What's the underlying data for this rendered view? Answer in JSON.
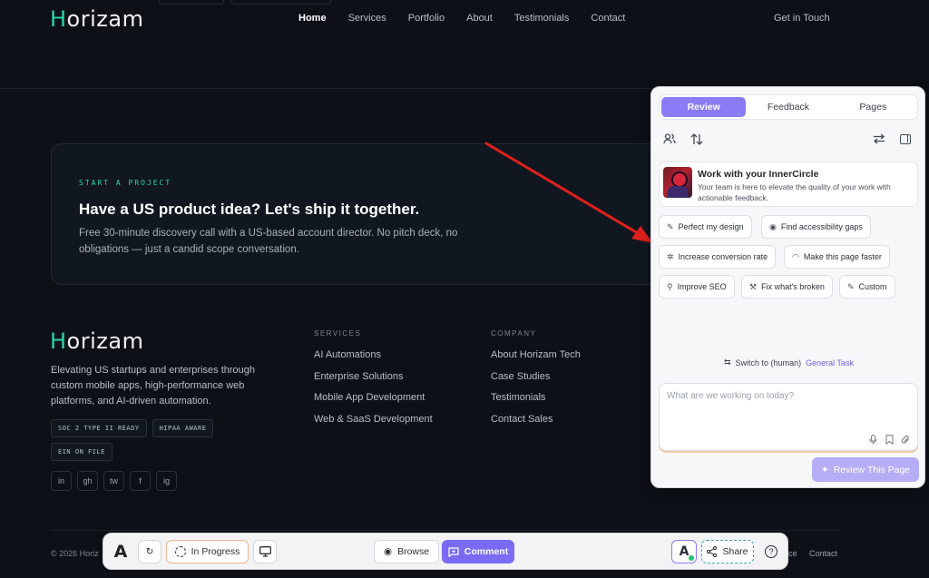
{
  "nav": {
    "logo_h": "H",
    "logo_rest": "orizam",
    "links": [
      "Home",
      "Services",
      "Portfolio",
      "About",
      "Testimonials",
      "Contact"
    ],
    "cta": "Get in Touch"
  },
  "card": {
    "eyebrow": "START A PROJECT",
    "headline": "Have a US product idea? Let's ship it together.",
    "sub": "Free 30-minute discovery call with a US-based account director. No pitch deck, no obligations — just a candid scope conversation."
  },
  "footer": {
    "logo_h": "H",
    "logo_rest": "orizam",
    "description": "Elevating US startups and enterprises through custom mobile apps, high-performance web platforms, and AI-driven automation.",
    "badges": [
      "SOC 2 TYPE II READY",
      "HIPAA AWARE",
      "EIN ON FILE"
    ],
    "socials": [
      "in",
      "gh",
      "tw",
      "f",
      "ig"
    ],
    "services": {
      "title": "SERVICES",
      "items": [
        "AI Automations",
        "Enterprise Solutions",
        "Mobile App Development",
        "Web & SaaS Development"
      ]
    },
    "company": {
      "title": "COMPANY",
      "items": [
        "About Horizam Tech",
        "Case Studies",
        "Testimonials",
        "Contact Sales"
      ]
    },
    "copyright": "© 2026 Horiz",
    "bottom_link_partial": "ce",
    "bottom_link_contact": "Contact"
  },
  "panel": {
    "tabs": [
      "Review",
      "Feedback",
      "Pages"
    ],
    "intro_title": "Work with your InnerCircle",
    "intro_body": "Your team is here to elevate the quality of your work with actionable feedback.",
    "chips": [
      "Perfect my design",
      "Find accessibility gaps",
      "Increase conversion rate",
      "Make this page faster",
      "Improve SEO",
      "Fix what's broken",
      "Custom"
    ],
    "switch_text": "Switch to (human)",
    "switch_link": "General Task",
    "composer_placeholder": "What are we working on today?",
    "review_button": "Review This Page"
  },
  "toolbar": {
    "logo": "A",
    "status": "In Progress",
    "browse": "Browse",
    "comment": "Comment",
    "avatar": "A",
    "share": "Share",
    "help": "?"
  },
  "colors": {
    "accent": "#8a7cf6",
    "brand_teal": "#2dd4a7",
    "background": "#0d1117"
  }
}
